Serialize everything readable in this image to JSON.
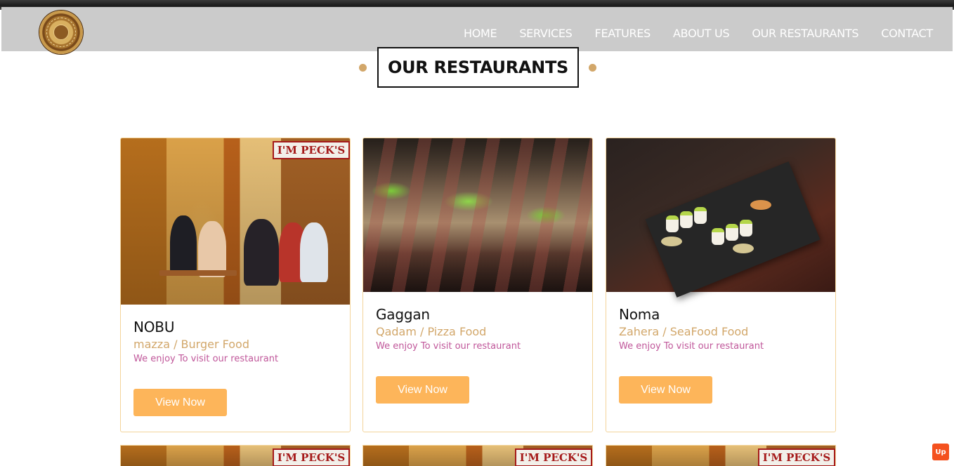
{
  "nav": {
    "items": [
      {
        "label": "HOME"
      },
      {
        "label": "SERVICES"
      },
      {
        "label": "FEATURES"
      },
      {
        "label": "ABOUT US"
      },
      {
        "label": "OUR RESTAURANTS"
      },
      {
        "label": "CONTACT"
      }
    ]
  },
  "section": {
    "title": "OUR RESTAURANTS"
  },
  "restaurants": [
    {
      "name": "NOBU",
      "subtitle": "mazza / Burger Food",
      "description": "We enjoy To visit our restaurant",
      "button": "View Now",
      "image": "cafe-street-photo",
      "sign_text": "I'M PECK'S"
    },
    {
      "name": "Gaggan",
      "subtitle": "Qadam / Pizza Food",
      "description": "We enjoy To visit our restaurant",
      "button": "View Now",
      "image": "food-platter-photo"
    },
    {
      "name": "Noma",
      "subtitle": "Zahera / SeaFood Food",
      "description": "We enjoy To visit our restaurant",
      "button": "View Now",
      "image": "sushi-slate-photo"
    }
  ],
  "scroll_top": {
    "label": "Up"
  },
  "colors": {
    "navbar": "#cbcbcb",
    "accent_gold": "#d2a76a",
    "button": "#fdb55a",
    "description": "#c0579a",
    "card_border": "#f3d49a",
    "up_button": "#f4511e"
  }
}
